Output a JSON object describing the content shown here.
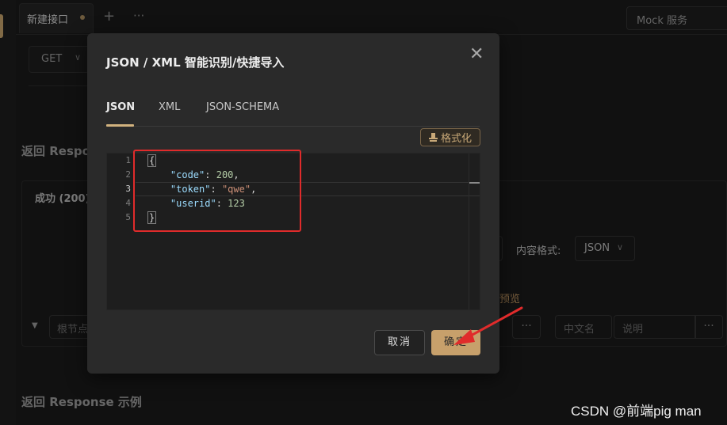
{
  "background": {
    "tab_label": "新建接口",
    "tab_plus": "+",
    "tab_more": "···",
    "mock_button": "Mock 服务",
    "method": "GET",
    "method_chevron": "∨",
    "response_title_partial": "返回 Respon",
    "success_label": "成功 (200)",
    "content_format_label": "内容格式:",
    "content_format_value": "JSON",
    "content_format_chevron": "∨",
    "preview_link": "预览",
    "root_placeholder": "根节点",
    "chinese_name_placeholder": "中文名",
    "description_placeholder": "说明",
    "dots": "···",
    "response_example_title": "返回 Response 示例"
  },
  "modal": {
    "title": "JSON / XML 智能识别/快捷导入",
    "close_glyph": "✕",
    "tabs": [
      {
        "label": "JSON",
        "active": true
      },
      {
        "label": "XML",
        "active": false
      },
      {
        "label": "JSON-SCHEMA",
        "active": false
      }
    ],
    "format_button": "格式化",
    "editor": {
      "line_numbers": [
        "1",
        "2",
        "3",
        "4",
        "5"
      ],
      "current_line": 3,
      "lines": [
        {
          "tokens": [
            {
              "t": "{",
              "c": "brace"
            }
          ]
        },
        {
          "tokens": [
            {
              "t": "    ",
              "c": ""
            },
            {
              "t": "\"code\"",
              "c": "k"
            },
            {
              "t": ": ",
              "c": ""
            },
            {
              "t": "200",
              "c": "n"
            },
            {
              "t": ",",
              "c": ""
            }
          ]
        },
        {
          "tokens": [
            {
              "t": "    ",
              "c": ""
            },
            {
              "t": "\"token\"",
              "c": "k"
            },
            {
              "t": ": ",
              "c": ""
            },
            {
              "t": "\"qwe\"",
              "c": "s"
            },
            {
              "t": ",",
              "c": ""
            }
          ]
        },
        {
          "tokens": [
            {
              "t": "    ",
              "c": ""
            },
            {
              "t": "\"userid\"",
              "c": "k"
            },
            {
              "t": ": ",
              "c": ""
            },
            {
              "t": "123",
              "c": "n"
            }
          ]
        },
        {
          "tokens": [
            {
              "t": "}",
              "c": "brace"
            }
          ]
        }
      ]
    },
    "cancel_button": "取消",
    "confirm_button": "确定"
  },
  "watermark": "CSDN @前端pig man",
  "colors": {
    "accent": "#c7a06b",
    "annotation_red": "#e02b2b"
  }
}
